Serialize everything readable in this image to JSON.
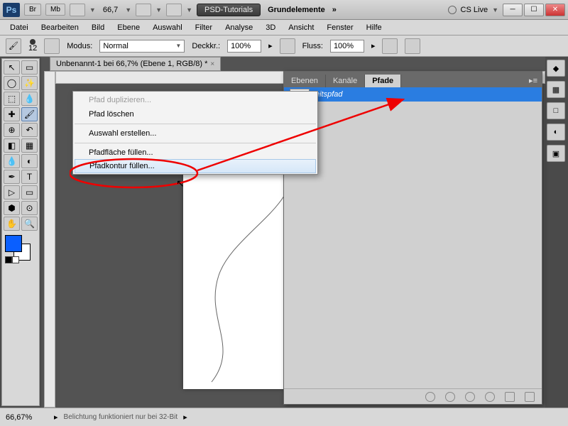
{
  "app": {
    "logo": "Ps"
  },
  "titlebar": {
    "chips": [
      "Br",
      "Mb"
    ],
    "zoom": "66,7",
    "workspace_btn": "PSD-Tutorials",
    "workspace_plain": "Grundelemente",
    "cslive": "CS Live"
  },
  "menubar": [
    "Datei",
    "Bearbeiten",
    "Bild",
    "Ebene",
    "Auswahl",
    "Filter",
    "Analyse",
    "3D",
    "Ansicht",
    "Fenster",
    "Hilfe"
  ],
  "optionsbar": {
    "brush_size": "12",
    "mode_label": "Modus:",
    "mode_value": "Normal",
    "opacity_label": "Deckkr.:",
    "opacity_value": "100%",
    "flow_label": "Fluss:",
    "flow_value": "100%"
  },
  "doc_tab": "Unbenannt-1 bei 66,7% (Ebene 1, RGB/8) *",
  "panel": {
    "tabs": [
      "Ebenen",
      "Kanäle",
      "Pfade"
    ],
    "active_tab": 2,
    "path_name": "eitspfad"
  },
  "context_menu": {
    "items": [
      {
        "label": "Pfad duplizieren...",
        "enabled": false
      },
      {
        "label": "Pfad löschen",
        "enabled": true
      },
      {
        "sep": true
      },
      {
        "label": "Auswahl erstellen...",
        "enabled": true
      },
      {
        "sep": true
      },
      {
        "label": "Pfadfläche füllen...",
        "enabled": true
      },
      {
        "label": "Pfadkontur füllen...",
        "enabled": true,
        "hover": true
      }
    ]
  },
  "statusbar": {
    "zoom": "66,67%",
    "msg": "Belichtung funktioniert nur bei 32-Bit"
  },
  "colors": {
    "fg": "#0a5fff",
    "bg": "#ffffff"
  }
}
